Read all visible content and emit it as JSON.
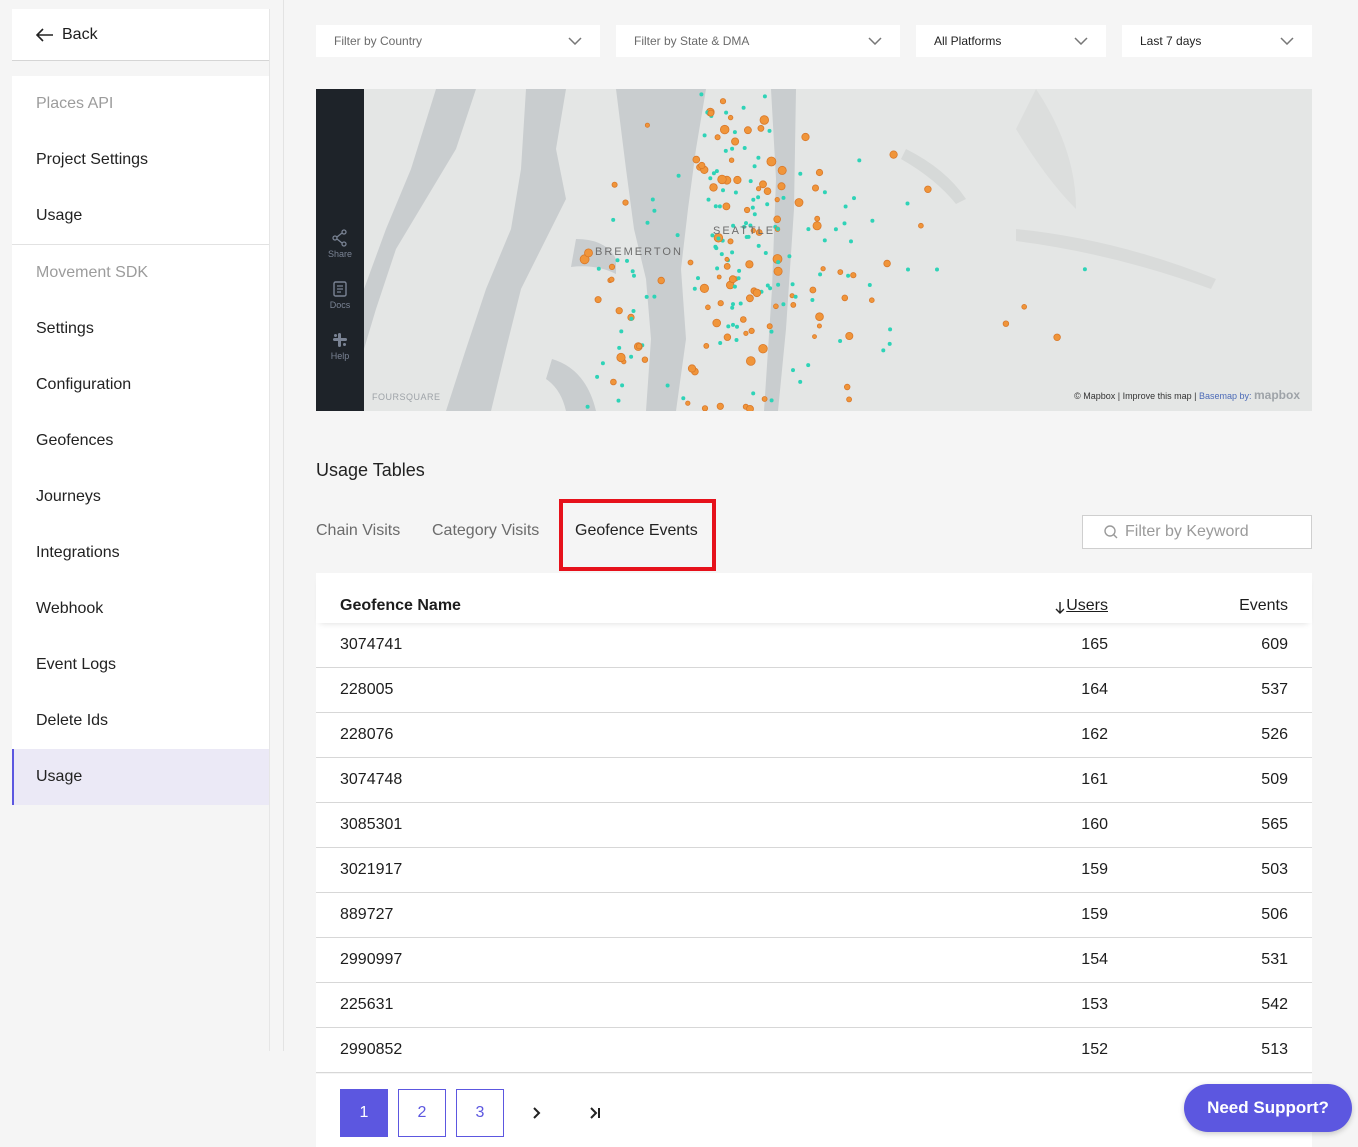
{
  "sidebar": {
    "back_label": "Back",
    "sections": [
      {
        "header": "Places API",
        "items": [
          "Project Settings",
          "Usage"
        ]
      },
      {
        "header": "Movement SDK",
        "items": [
          "Settings",
          "Configuration",
          "Geofences",
          "Journeys",
          "Integrations",
          "Webhook",
          "Event Logs",
          "Delete Ids",
          "Usage"
        ]
      }
    ],
    "active_item": "Usage"
  },
  "filters": {
    "country": "Filter by Country",
    "state": "Filter by State & DMA",
    "platform": "All Platforms",
    "range": "Last 7 days"
  },
  "map": {
    "buttons": {
      "share": "Share",
      "docs": "Docs",
      "help": "Help"
    },
    "cities": {
      "bremerton": "BREMERTON",
      "seattle": "SEATTLE"
    },
    "logo": "FOURSQUARE",
    "attribution": {
      "mapbox": "© Mapbox",
      "improve": "Improve this map",
      "basemap": "Basemap by:",
      "brand": "mapbox"
    },
    "colors": {
      "visits": "#f0953a",
      "events": "#2ed3b7",
      "water": "#c9cdcf",
      "land": "#e4e6e5"
    }
  },
  "usage": {
    "title": "Usage Tables",
    "tabs": [
      "Chain Visits",
      "Category Visits",
      "Geofence Events"
    ],
    "active_tab": "Geofence Events",
    "search_placeholder": "Filter by Keyword",
    "columns": {
      "name": "Geofence Name",
      "users": "Users",
      "events": "Events"
    },
    "rows": [
      {
        "name": "3074741",
        "users": "165",
        "events": "609"
      },
      {
        "name": "228005",
        "users": "164",
        "events": "537"
      },
      {
        "name": "228076",
        "users": "162",
        "events": "526"
      },
      {
        "name": "3074748",
        "users": "161",
        "events": "509"
      },
      {
        "name": "3085301",
        "users": "160",
        "events": "565"
      },
      {
        "name": "3021917",
        "users": "159",
        "events": "503"
      },
      {
        "name": "889727",
        "users": "159",
        "events": "506"
      },
      {
        "name": "2990997",
        "users": "154",
        "events": "531"
      },
      {
        "name": "225631",
        "users": "153",
        "events": "542"
      },
      {
        "name": "2990852",
        "users": "152",
        "events": "513"
      }
    ],
    "pages": [
      "1",
      "2",
      "3"
    ],
    "current_page": "1",
    "next_icon": "chevron-right-icon",
    "last_icon": "last-page-icon"
  },
  "support_label": "Need Support?",
  "accent_color": "#5c57e0",
  "highlight_color": "#e6111b"
}
